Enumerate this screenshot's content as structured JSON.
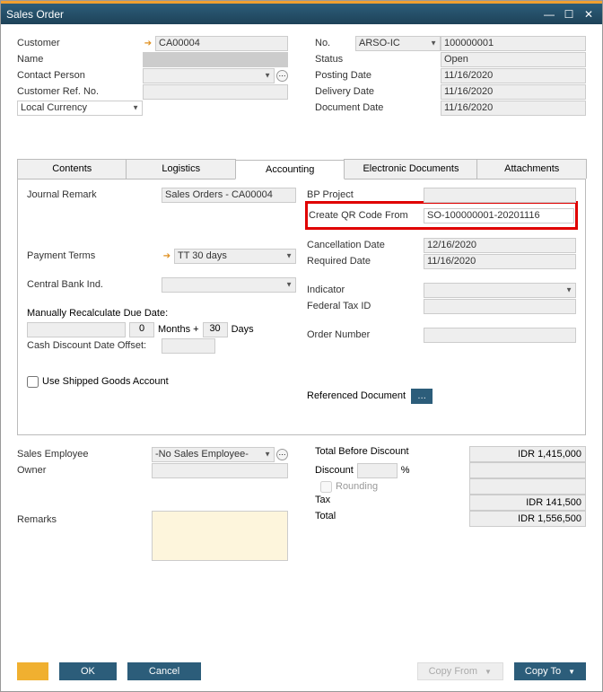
{
  "window": {
    "title": "Sales Order"
  },
  "header": {
    "left": {
      "customer_lbl": "Customer",
      "customer_val": "CA00004",
      "name_lbl": "Name",
      "name_val": "",
      "contact_lbl": "Contact Person",
      "contact_val": "",
      "custref_lbl": "Customer Ref. No.",
      "custref_val": "",
      "currency_val": "Local Currency"
    },
    "right": {
      "no_lbl": "No.",
      "no_series": "ARSO-IC",
      "no_val": "100000001",
      "status_lbl": "Status",
      "status_val": "Open",
      "posting_lbl": "Posting Date",
      "posting_val": "11/16/2020",
      "delivery_lbl": "Delivery Date",
      "delivery_val": "11/16/2020",
      "docdate_lbl": "Document Date",
      "docdate_val": "11/16/2020"
    }
  },
  "tabs": {
    "contents": "Contents",
    "logistics": "Logistics",
    "accounting": "Accounting",
    "edocs": "Electronic Documents",
    "attachments": "Attachments"
  },
  "accounting": {
    "left": {
      "journal_lbl": "Journal Remark",
      "journal_val": "Sales Orders - CA00004",
      "payterm_lbl": "Payment Terms",
      "payterm_val": "TT 30 days",
      "cbi_lbl": "Central Bank Ind.",
      "cbi_val": "",
      "manrecalc_lbl": "Manually Recalculate Due Date:",
      "months_val": "0",
      "months_lbl": "Months  +",
      "days_val": "30",
      "days_lbl": "Days",
      "offset_lbl": "Cash Discount Date Offset:",
      "offset_val": "",
      "shipped_lbl": "Use Shipped Goods Account"
    },
    "right": {
      "bpproj_lbl": "BP Project",
      "bpproj_val": "",
      "qr_lbl": "Create QR Code From",
      "qr_val": "SO-100000001-20201116",
      "cancel_lbl": "Cancellation Date",
      "cancel_val": "12/16/2020",
      "reqdate_lbl": "Required Date",
      "reqdate_val": "11/16/2020",
      "indicator_lbl": "Indicator",
      "indicator_val": "",
      "fedtax_lbl": "Federal Tax ID",
      "fedtax_val": "",
      "orderno_lbl": "Order Number",
      "orderno_val": "",
      "refdoc_lbl": "Referenced Document"
    }
  },
  "bottom": {
    "salesemp_lbl": "Sales Employee",
    "salesemp_val": "-No Sales Employee-",
    "owner_lbl": "Owner",
    "owner_val": "",
    "remarks_lbl": "Remarks",
    "remarks_val": "",
    "tbd_lbl": "Total Before Discount",
    "tbd_val": "IDR 1,415,000",
    "disc_lbl": "Discount",
    "disc_pct": "",
    "pct_sign": "%",
    "disc_val": "",
    "rounding_lbl": "Rounding",
    "rounding_val": "",
    "tax_lbl": "Tax",
    "tax_val": "IDR 141,500",
    "total_lbl": "Total",
    "total_val": "IDR 1,556,500"
  },
  "footer": {
    "ok": "OK",
    "cancel": "Cancel",
    "copyfrom": "Copy From",
    "copyto": "Copy To"
  }
}
